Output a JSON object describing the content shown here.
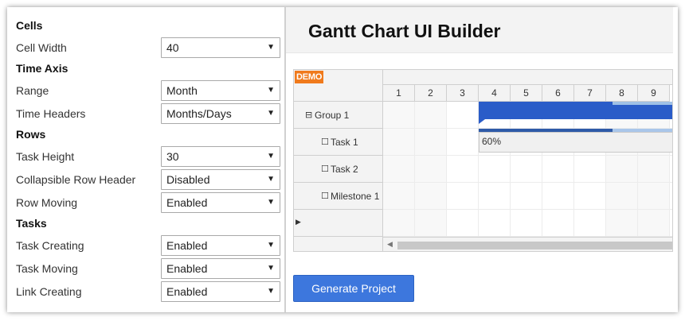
{
  "settings": {
    "sections": {
      "cells": "Cells",
      "time_axis": "Time Axis",
      "rows": "Rows",
      "tasks": "Tasks"
    },
    "fields": [
      {
        "label": "Cell Width",
        "value": "40"
      },
      {
        "label": "Range",
        "value": "Month"
      },
      {
        "label": "Time Headers",
        "value": "Months/Days"
      },
      {
        "label": "Task Height",
        "value": "30"
      },
      {
        "label": "Collapsible Row Header",
        "value": "Disabled"
      },
      {
        "label": "Row Moving",
        "value": "Enabled"
      },
      {
        "label": "Task Creating",
        "value": "Enabled"
      },
      {
        "label": "Task Moving",
        "value": "Enabled"
      },
      {
        "label": "Link Creating",
        "value": "Enabled"
      }
    ]
  },
  "header": {
    "title": "Gantt Chart UI Builder"
  },
  "gantt": {
    "demo_badge": "DEMO",
    "days": [
      "1",
      "2",
      "3",
      "4",
      "5",
      "6",
      "7",
      "8",
      "9"
    ],
    "rows": [
      {
        "toggle": "⊟",
        "label": "Group 1"
      },
      {
        "toggle": "☐",
        "label": "Task 1"
      },
      {
        "toggle": "☐",
        "label": "Task 2"
      },
      {
        "toggle": "☐",
        "label": "Milestone 1"
      }
    ],
    "task_progress": "60%",
    "colors": {
      "group_bar": "#2a5cc8",
      "progress": "#2e5aa8",
      "accent": "#f07a1c"
    }
  },
  "actions": {
    "generate": "Generate Project"
  }
}
